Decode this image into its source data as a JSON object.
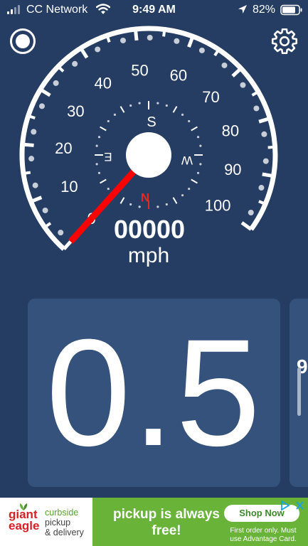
{
  "status_bar": {
    "carrier": "CC Network",
    "time": "9:49 AM",
    "battery_pct": "82%",
    "battery_level": 0.82,
    "icons": [
      "signal-icon",
      "wifi-icon",
      "location-arrow-icon",
      "battery-icon"
    ]
  },
  "toolbar": {
    "record_icon": "record-icon",
    "settings_icon": "gear-icon"
  },
  "speedometer": {
    "speed_ticks": [
      "0",
      "10",
      "20",
      "30",
      "40",
      "50",
      "60",
      "70",
      "80",
      "90",
      "100"
    ],
    "needle_value": 0,
    "odometer": "00000",
    "unit": "mph",
    "compass": {
      "north": "N",
      "south": "S",
      "east": "E",
      "west": "W",
      "heading_deg": 0
    },
    "colors": {
      "needle": "#ff0000",
      "dial": "#ffffff",
      "background": "#253d63"
    }
  },
  "panel": {
    "value": "0.5",
    "next_panel_fragment": "9"
  },
  "ad": {
    "brand_line1": "giant",
    "brand_line2": "eagle",
    "tagline": [
      "curbside",
      "pickup",
      "& delivery"
    ],
    "headline": "pickup is always free!",
    "cta": "Shop Now",
    "fine_print": "First order only. Must use Advantage Card.",
    "colors": {
      "green": "#69b339",
      "red": "#d71f26"
    }
  }
}
